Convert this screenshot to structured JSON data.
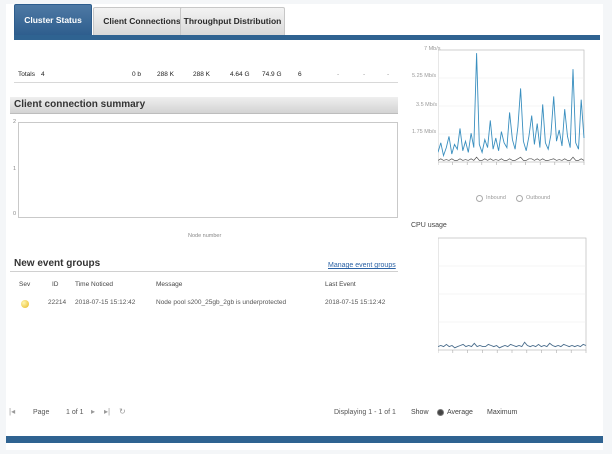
{
  "tabs": [
    {
      "label": "Cluster Status",
      "active": true
    },
    {
      "label": "Client Connections",
      "active": false
    },
    {
      "label": "Throughput Distribution",
      "active": false
    }
  ],
  "totals": {
    "label": "Totals",
    "count": "4",
    "values": [
      "0 b",
      "288 K",
      "288 K",
      "4.64 G",
      "74.9 G",
      "6",
      "-",
      "-",
      "-"
    ]
  },
  "client_summary": {
    "title": "Client connection summary",
    "y_ticks": [
      "2",
      "1",
      "0"
    ],
    "x_label": "Node number"
  },
  "events": {
    "title": "New event groups",
    "manage_link": "Manage event groups",
    "columns": [
      "Sev",
      "ID",
      "Time Noticed",
      "Message",
      "Last Event"
    ],
    "rows": [
      {
        "sev": "info",
        "id": "22214",
        "time": "2018-07-15 15:12:42",
        "message": "Node pool s200_25gb_2gb is underprotected",
        "last": "2018-07-15 15:12:42"
      }
    ]
  },
  "pager": {
    "page_label": "Page",
    "page_value": "1 of 1",
    "displaying": "Displaying 1 - 1 of 1"
  },
  "throughput_chart": {
    "y_ticks": [
      "7 Mb/s",
      "5.25 Mb/s",
      "3.5 Mb/s",
      "1.75 Mb/s"
    ],
    "legend": [
      "Inbound",
      "Outbound"
    ]
  },
  "cpu": {
    "title": "CPU usage",
    "show_label": "Show",
    "options": [
      "Average",
      "Maximum"
    ],
    "selected": "Average"
  },
  "colors": {
    "accent": "#2f6391",
    "series": "#3a8fbf"
  },
  "chart_data": [
    {
      "type": "line",
      "y_ticks": [
        "7 Mb/s",
        "5.25 Mb/s",
        "3.5 Mb/s",
        "1.75 Mb/s"
      ],
      "ylim": [
        0,
        7
      ],
      "series": [
        {
          "name": "Inbound",
          "values": [
            0.6,
            1.2,
            0.4,
            0.9,
            1.6,
            0.5,
            1.1,
            0.8,
            2.1,
            0.7,
            1.3,
            0.6,
            1.8,
            0.9,
            6.8,
            1.1,
            0.6,
            1.4,
            0.9,
            2.6,
            0.8,
            1.5,
            0.7,
            1.9,
            1.2,
            0.9,
            3.1,
            1.4,
            0.8,
            2.2,
            4.6,
            1.3,
            0.7,
            1.6,
            2.9,
            1.1,
            2.4,
            0.9,
            3.6,
            1.2,
            0.8,
            1.7,
            4.1,
            1.3,
            2.0,
            1.0,
            3.3,
            1.6,
            0.9,
            5.8,
            1.2,
            0.8,
            3.9,
            1.5
          ]
        },
        {
          "name": "Outbound",
          "values": [
            0.1,
            0.2,
            0.1,
            0.15,
            0.1,
            0.2,
            0.1,
            0.1,
            0.2,
            0.1,
            0.15,
            0.1,
            0.2,
            0.1,
            0.3,
            0.1,
            0.1,
            0.2,
            0.1,
            0.2,
            0.1,
            0.15,
            0.1,
            0.2,
            0.1,
            0.1,
            0.2,
            0.1,
            0.1,
            0.2,
            0.3,
            0.1,
            0.1,
            0.2,
            0.2,
            0.1,
            0.2,
            0.1,
            0.2,
            0.1,
            0.1,
            0.15,
            0.2,
            0.1,
            0.15,
            0.1,
            0.2,
            0.1,
            0.1,
            0.3,
            0.1,
            0.1,
            0.2,
            0.1
          ]
        }
      ]
    },
    {
      "type": "line",
      "title": "CPU usage",
      "ylim": [
        0,
        100
      ],
      "series": [
        {
          "name": "CPU",
          "values": [
            3,
            4,
            3,
            5,
            3,
            4,
            2,
            3,
            4,
            5,
            3,
            4,
            3,
            6,
            3,
            4,
            3,
            3,
            5,
            4,
            3,
            4,
            2,
            3,
            4,
            3,
            5,
            4,
            3,
            4,
            3,
            7,
            4,
            3,
            4,
            3,
            5,
            3,
            4,
            3,
            6,
            4,
            3,
            4,
            3,
            5,
            4,
            3,
            4,
            3,
            4,
            3,
            5,
            4
          ]
        }
      ]
    }
  ]
}
